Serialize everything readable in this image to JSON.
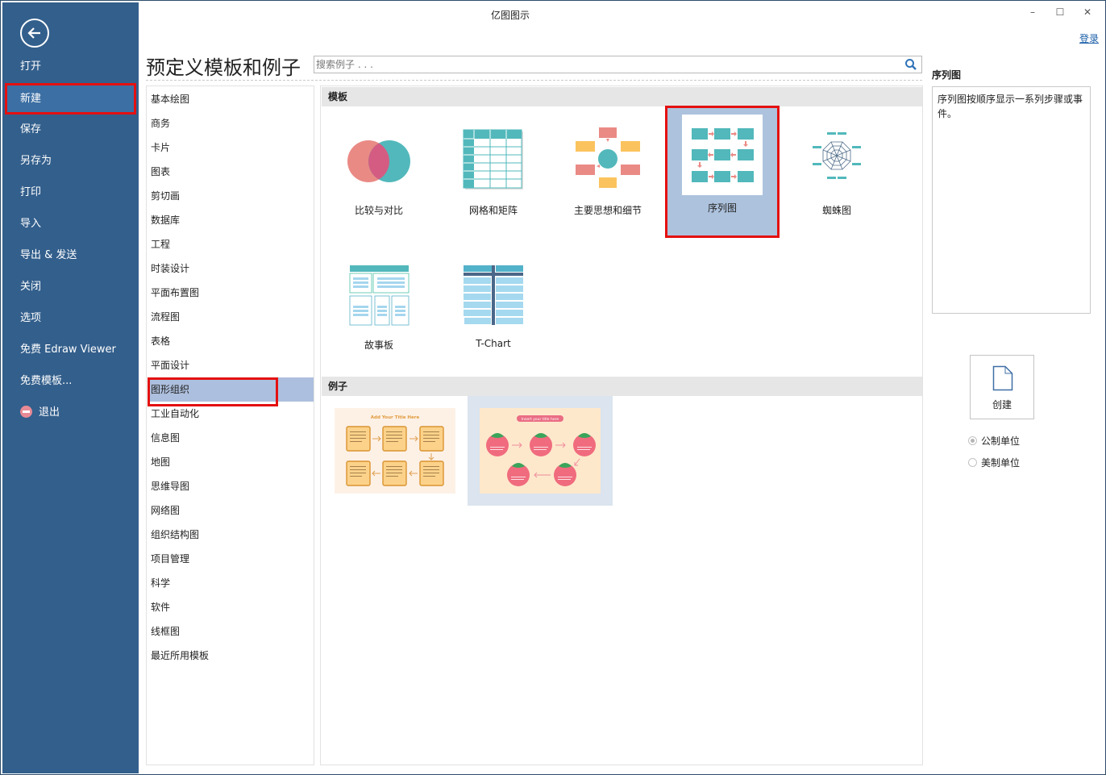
{
  "window": {
    "title": "亿图图示",
    "controls": {
      "minimize": "–",
      "maximize": "☐",
      "close": "✕"
    },
    "login_label": "登录"
  },
  "sidebar": {
    "back_icon": "back-arrow-icon",
    "items": [
      {
        "label": "打开",
        "selected": false
      },
      {
        "label": "新建",
        "selected": true
      },
      {
        "label": "保存",
        "selected": false
      },
      {
        "label": "另存为",
        "selected": false
      },
      {
        "label": "打印",
        "selected": false
      },
      {
        "label": "导入",
        "selected": false
      },
      {
        "label": "导出 & 发送",
        "selected": false
      },
      {
        "label": "关闭",
        "selected": false
      },
      {
        "label": "选项",
        "selected": false
      },
      {
        "label": "免费 Edraw Viewer",
        "selected": false
      },
      {
        "label": "免费模板...",
        "selected": false
      },
      {
        "label": "退出",
        "selected": false,
        "icon": "exit-icon"
      }
    ]
  },
  "header": {
    "title": "预定义模板和例子",
    "search_placeholder": "搜索例子 . . ."
  },
  "categories": [
    "基本绘图",
    "商务",
    "卡片",
    "图表",
    "剪切画",
    "数据库",
    "工程",
    "时装设计",
    "平面布置图",
    "流程图",
    "表格",
    "平面设计",
    "图形组织",
    "工业自动化",
    "信息图",
    "地图",
    "思维导图",
    "网络图",
    "组织结构图",
    "项目管理",
    "科学",
    "软件",
    "线框图",
    "最近所用模板"
  ],
  "selected_category": "图形组织",
  "main": {
    "templates_header": "模板",
    "examples_header": "例子",
    "templates": [
      {
        "label": "比较与对比",
        "icon": "venn-diagram-icon"
      },
      {
        "label": "网格和矩阵",
        "icon": "grid-matrix-icon"
      },
      {
        "label": "主要思想和细节",
        "icon": "main-idea-icon"
      },
      {
        "label": "序列图",
        "icon": "sequence-diagram-icon",
        "selected": true
      },
      {
        "label": "蜘蛛图",
        "icon": "spider-diagram-icon"
      },
      {
        "label": "故事板",
        "icon": "storyboard-icon"
      },
      {
        "label": "T-Chart",
        "icon": "t-chart-icon"
      }
    ],
    "examples": [
      {
        "title": "Add Your Title Here",
        "style": "toast-sequence"
      },
      {
        "title": "Insert your title here",
        "style": "tomato-sequence",
        "selected": true
      }
    ]
  },
  "details": {
    "title": "序列图",
    "description": "序列图按顺序显示一系列步骤或事件。",
    "create_label": "创建",
    "units": [
      {
        "label": "公制单位",
        "checked": true
      },
      {
        "label": "美制单位",
        "checked": false
      }
    ]
  },
  "colors": {
    "sidebar_bg": "#335f8c",
    "sidebar_selected": "#3c6fa3",
    "highlight_red": "#e41010",
    "selection_bg": "#adbfde",
    "teal": "#52b8bb",
    "coral": "#ea8a85",
    "yellow": "#fbc35e"
  }
}
